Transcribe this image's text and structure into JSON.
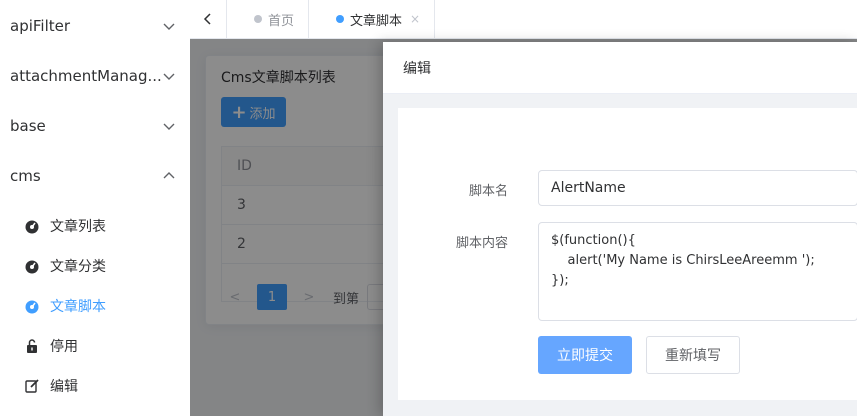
{
  "sidebar": {
    "groups": [
      {
        "label": "apiFilter",
        "expanded": false,
        "icon": "chevron-down-icon"
      },
      {
        "label": "attachmentManag...",
        "expanded": false,
        "icon": "chevron-down-icon"
      },
      {
        "label": "base",
        "expanded": false,
        "icon": "chevron-down-icon"
      },
      {
        "label": "cms",
        "expanded": true,
        "icon": "chevron-up-icon"
      }
    ],
    "cms_items": [
      {
        "label": "文章列表",
        "icon": "dashboard-icon",
        "active": false
      },
      {
        "label": "文章分类",
        "icon": "dashboard-icon",
        "active": false
      },
      {
        "label": "文章脚本",
        "icon": "dashboard-icon",
        "active": true
      },
      {
        "label": "停用",
        "icon": "unlock-icon",
        "active": false
      },
      {
        "label": "编辑",
        "icon": "edit-icon",
        "active": false
      }
    ]
  },
  "tabs": [
    {
      "label": "首页",
      "active": false
    },
    {
      "label": "文章脚本",
      "active": true,
      "close": "×"
    }
  ],
  "card": {
    "title": "Cms文章脚本列表",
    "add_button": "添加",
    "table_header": "ID",
    "rows": [
      "3",
      "2"
    ],
    "pagination": {
      "page": "1",
      "goto": "到第"
    }
  },
  "drawer": {
    "title": "编辑",
    "name_label": "脚本名",
    "name_value": "AlertName",
    "content_label": "脚本内容",
    "content_value": "$(function(){\n    alert('My Name is ChirsLeeAreemm ');\n});",
    "submit_label": "立即提交",
    "reset_label": "重新填写"
  },
  "colors": {
    "accent": "#409eff",
    "submit": "#66a6ff",
    "overlay": "rgba(0,0,0,0.45)"
  }
}
